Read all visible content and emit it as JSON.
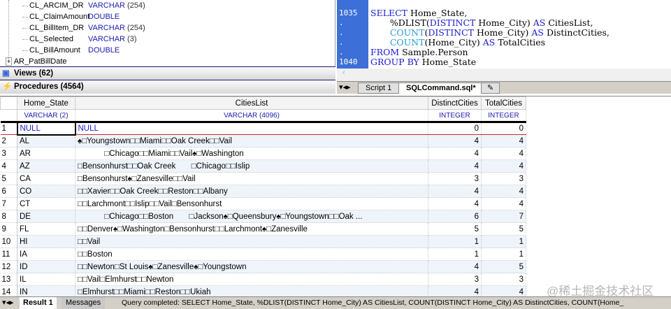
{
  "tree": {
    "columns": [
      {
        "name": "CL_ARCIM_DR",
        "type": "VARCHAR",
        "len": "(254)"
      },
      {
        "name": "CL_ClaimAmount",
        "type": "DOUBLE",
        "len": ""
      },
      {
        "name": "CL_BillItem_DR",
        "type": "VARCHAR",
        "len": "(254)"
      },
      {
        "name": "CL_Selected",
        "type": "VARCHAR",
        "len": "(3)"
      },
      {
        "name": "CL_BillAmount",
        "type": "DOUBLE",
        "len": ""
      }
    ],
    "next_table": "AR_PatBillDate",
    "views": "Views (62)",
    "procedures": "Procedures (4564)"
  },
  "editor": {
    "line_numbers": [
      "",
      "1035",
      ".",
      ".",
      ".",
      ".",
      "1040"
    ],
    "tabs": [
      "Script 1",
      "SQLCommand.sql*"
    ]
  },
  "grid": {
    "headers": [
      "Home_State",
      "CitiesList",
      "DistinctCities",
      "TotalCities"
    ],
    "types": [
      "VARCHAR (2)",
      "VARCHAR (4096)",
      "INTEGER",
      "INTEGER"
    ],
    "rows": [
      [
        "1",
        "NULL",
        "NULL",
        "0",
        "0"
      ],
      [
        "2",
        "AL",
        "♠□Youngstown□□Miami□□Oak Creek□□Vail",
        "4",
        "4"
      ],
      [
        "3",
        "AR",
        "            □Chicago□□Miami□□Vail♠□Washington",
        "4",
        "4"
      ],
      [
        "4",
        "AZ",
        "□Bensonhurst□□Oak Creek       □Chicago□□Islip",
        "4",
        "4"
      ],
      [
        "5",
        "CA",
        "□Bensonhurst♠□Zanesville□□Vail",
        "3",
        "3"
      ],
      [
        "6",
        "CO",
        "□□Xavier□□Oak Creek□□Reston□□Albany",
        "4",
        "4"
      ],
      [
        "7",
        "CT",
        "□□Larchmont□□Islip□□Vail□Bensonhurst",
        "4",
        "4"
      ],
      [
        "8",
        "DE",
        "            □Chicago□□Boston       □Jackson♠□Queensbury♠□Youngstown□□Oak ...",
        "6",
        "7"
      ],
      [
        "9",
        "FL",
        "□□Denver♠□Washington□Bensonhurst□□Larchmont♠□Zanesville",
        "5",
        "5"
      ],
      [
        "10",
        "HI",
        "□□Vail",
        "1",
        "1"
      ],
      [
        "11",
        "IA",
        "□□Boston",
        "1",
        "1"
      ],
      [
        "12",
        "ID",
        "□□Newton□St Louis♠□Zanesville♠□Youngstown",
        "4",
        "5"
      ],
      [
        "13",
        "IL",
        "□□Vail□Elmhurst□□Newton",
        "3",
        "3"
      ],
      [
        "14",
        "IN",
        "□Elmhurst□□Miami□□Reston□□Ukiah",
        "4",
        "4"
      ]
    ]
  },
  "status": {
    "tabs": [
      "Result 1",
      "Messages"
    ],
    "message": "Query completed: SELECT Home_State,        %DLIST(DISTINCT Home_City) AS CitiesList,        COUNT(DISTINCT Home_City) AS DistinctCities,        COUNT(Home_"
  },
  "watermark": "@稀土掘金技术社区"
}
